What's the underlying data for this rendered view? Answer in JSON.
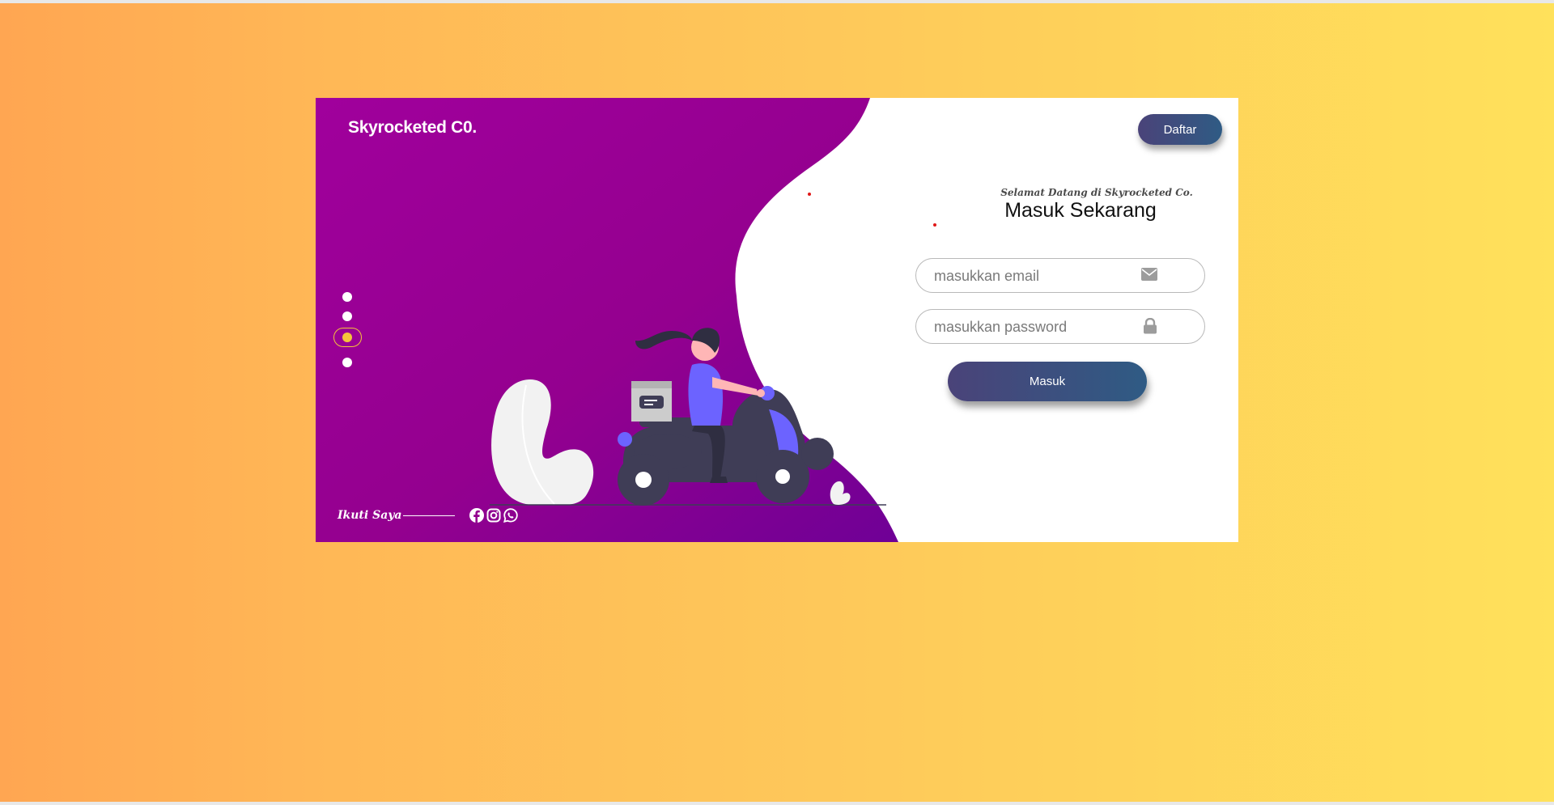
{
  "brand": {
    "name": "Skyrocketed C0."
  },
  "header": {
    "register_label": "Daftar"
  },
  "slider": {
    "dots": 4,
    "active_index": 3
  },
  "login": {
    "welcome": "Selamat Datang di Skyrocketed Co.",
    "title": "Masuk Sekarang",
    "email_placeholder": "masukkan email",
    "password_placeholder": "masukkan password",
    "submit_label": "Masuk"
  },
  "footer": {
    "follow_label": "Ikuti Saya"
  },
  "icons": {
    "email": "envelope-icon",
    "password": "lock-icon",
    "social": [
      "facebook-icon",
      "instagram-icon",
      "whatsapp-icon"
    ]
  },
  "colors": {
    "background_start": "#ffa652",
    "background_end": "#ffe15b",
    "panel_purple": "#990096",
    "button_start": "#4a4379",
    "button_end": "#2f5b84",
    "accent_yellow": "#f5c33b"
  }
}
